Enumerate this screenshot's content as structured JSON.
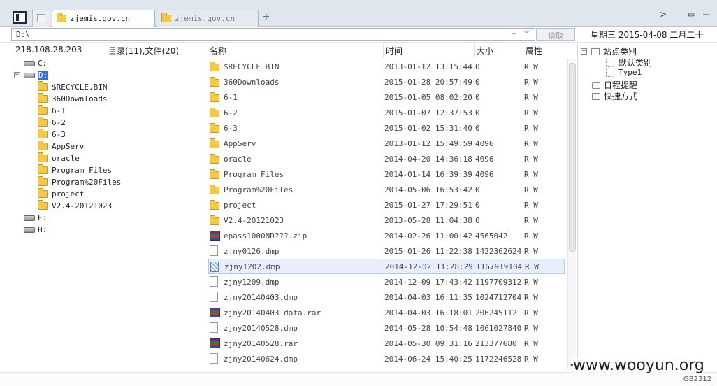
{
  "tabs": [
    {
      "label": "zjemis.gov.cn",
      "active": true
    },
    {
      "label": "zjemis.gov.cn",
      "active": false
    }
  ],
  "new_tab": "+",
  "window_controls": {
    "chevron": ">",
    "restore": "▭",
    "minimize": "–"
  },
  "address": {
    "value": "D:\\",
    "plus": "±",
    "dropdown": "﹀",
    "read_button": "读取"
  },
  "date_bar": "星期三  2015-04-08  二月二十",
  "left": {
    "ip": "218.108.28.203",
    "summary": "目录(11),文件(20)"
  },
  "tree": [
    {
      "label": "C:",
      "type": "drive",
      "level": 0
    },
    {
      "label": "D:",
      "type": "drive",
      "level": 0,
      "selected": true,
      "expanded": true
    },
    {
      "label": "$RECYCLE.BIN",
      "type": "folder",
      "level": 1
    },
    {
      "label": "360Downloads",
      "type": "folder",
      "level": 1
    },
    {
      "label": "6-1",
      "type": "folder",
      "level": 1
    },
    {
      "label": "6-2",
      "type": "folder",
      "level": 1
    },
    {
      "label": "6-3",
      "type": "folder",
      "level": 1
    },
    {
      "label": "AppServ",
      "type": "folder",
      "level": 1
    },
    {
      "label": "oracle",
      "type": "folder",
      "level": 1
    },
    {
      "label": "Program Files",
      "type": "folder",
      "level": 1
    },
    {
      "label": "Program%20Files",
      "type": "folder",
      "level": 1
    },
    {
      "label": "project",
      "type": "folder",
      "level": 1
    },
    {
      "label": "V2.4-20121023",
      "type": "folder",
      "level": 1
    },
    {
      "label": "E:",
      "type": "drive",
      "level": 0
    },
    {
      "label": "H:",
      "type": "drive",
      "level": 0
    }
  ],
  "columns": {
    "name": "名称",
    "time": "时间",
    "size": "大小",
    "attr": "属性"
  },
  "files": [
    {
      "name": "$RECYCLE.BIN",
      "time": "2013-01-12 13:15:44",
      "size": "0",
      "attr": "R W",
      "type": "folder"
    },
    {
      "name": "360Downloads",
      "time": "2015-01-28 20:57:49",
      "size": "0",
      "attr": "R W",
      "type": "folder"
    },
    {
      "name": "6-1",
      "time": "2015-01-05 08:02:20",
      "size": "0",
      "attr": "R W",
      "type": "folder"
    },
    {
      "name": "6-2",
      "time": "2015-01-07 12:37:53",
      "size": "0",
      "attr": "R W",
      "type": "folder"
    },
    {
      "name": "6-3",
      "time": "2015-01-02 15:31:40",
      "size": "0",
      "attr": "R W",
      "type": "folder"
    },
    {
      "name": "AppServ",
      "time": "2013-01-12 15:49:59",
      "size": "4096",
      "attr": "R W",
      "type": "folder"
    },
    {
      "name": "oracle",
      "time": "2014-04-20 14:36:18",
      "size": "4096",
      "attr": "R W",
      "type": "folder"
    },
    {
      "name": "Program Files",
      "time": "2014-01-14 16:39:39",
      "size": "4096",
      "attr": "R W",
      "type": "folder"
    },
    {
      "name": "Program%20Files",
      "time": "2014-05-06 16:53:42",
      "size": "0",
      "attr": "R W",
      "type": "folder"
    },
    {
      "name": "project",
      "time": "2015-01-27 17:29:51",
      "size": "0",
      "attr": "R W",
      "type": "folder"
    },
    {
      "name": "V2.4-20121023",
      "time": "2013-05-28 11:04:38",
      "size": "0",
      "attr": "R W",
      "type": "folder"
    },
    {
      "name": "epass1000ND???.zip",
      "time": "2014-02-26 11:00:42",
      "size": "4565042",
      "attr": "R W",
      "type": "archive"
    },
    {
      "name": "zjny0126.dmp",
      "time": "2015-01-26 11:22:38",
      "size": "1422362624",
      "attr": "R W",
      "type": "file"
    },
    {
      "name": "zjny1202.dmp",
      "time": "2014-12-02 11:28:29",
      "size": "1167919104",
      "attr": "R W",
      "type": "file-hatch",
      "highlight": true
    },
    {
      "name": "zjny1209.dmp",
      "time": "2014-12-09 17:43:42",
      "size": "1197709312",
      "attr": "R W",
      "type": "file"
    },
    {
      "name": "zjny20140403.dmp",
      "time": "2014-04-03 16:11:35",
      "size": "1024712704",
      "attr": "R W",
      "type": "file"
    },
    {
      "name": "zjny20140403_data.rar",
      "time": "2014-04-03 16:18:01",
      "size": "206245112",
      "attr": "R W",
      "type": "archive"
    },
    {
      "name": "zjny20140528.dmp",
      "time": "2014-05-28 10:54:48",
      "size": "1061027840",
      "attr": "R W",
      "type": "file"
    },
    {
      "name": "zjny20140528.rar",
      "time": "2014-05-30 09:31:16",
      "size": "213377680",
      "attr": "R W",
      "type": "archive"
    },
    {
      "name": "zjny20140624.dmp",
      "time": "2014-06-24 15:40:25",
      "size": "1172246528",
      "attr": "R W",
      "type": "file"
    }
  ],
  "right_panel": {
    "category": "站点类别",
    "items": [
      "默认类别",
      "Type1"
    ],
    "schedule": "日程提醒",
    "shortcuts": "快捷方式"
  },
  "watermark": "www.wooyun.org",
  "encoding": "GB2312"
}
